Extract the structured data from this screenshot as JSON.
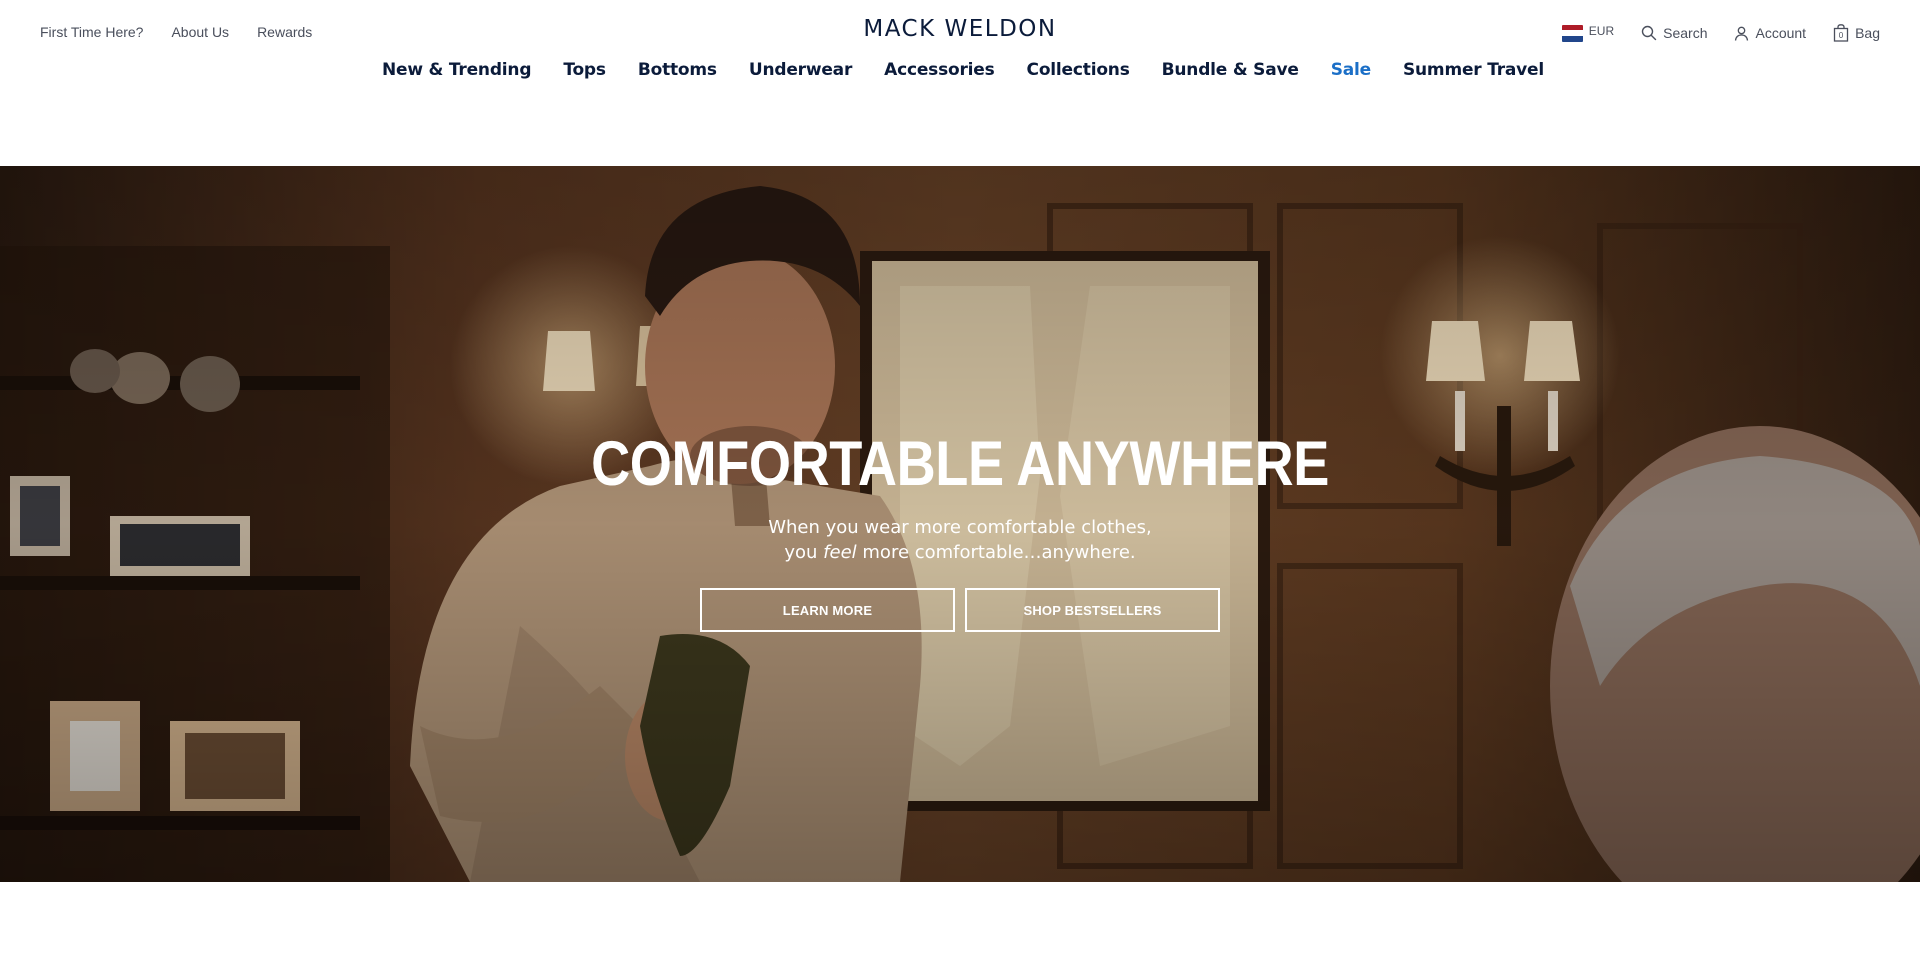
{
  "brand": {
    "logo_text": "MACK WELDON"
  },
  "utility_left": {
    "first_time": "First Time Here?",
    "about": "About Us",
    "rewards": "Rewards"
  },
  "utility_right": {
    "currency": "EUR",
    "search": "Search",
    "account": "Account",
    "bag": "Bag",
    "bag_count": "0",
    "icons": {
      "currency": "nl-flag-icon",
      "search": "search-icon",
      "account": "account-icon",
      "bag": "bag-icon"
    }
  },
  "nav": {
    "items": [
      "New & Trending",
      "Tops",
      "Bottoms",
      "Underwear",
      "Accessories",
      "Collections",
      "Bundle & Save",
      "Sale",
      "Summer Travel"
    ],
    "sale_color": "#1b6fc7",
    "text_color": "#0b1b3a"
  },
  "hero": {
    "title": "COMFORTABLE ANYWHERE",
    "subtitle_line1": "When you wear more comfortable clothes,",
    "subtitle_line2_pre": "you ",
    "subtitle_line2_em": "feel",
    "subtitle_line2_post": " more comfortable…anywhere.",
    "cta_primary": "LEARN MORE",
    "cta_secondary": "SHOP BESTSELLERS"
  }
}
